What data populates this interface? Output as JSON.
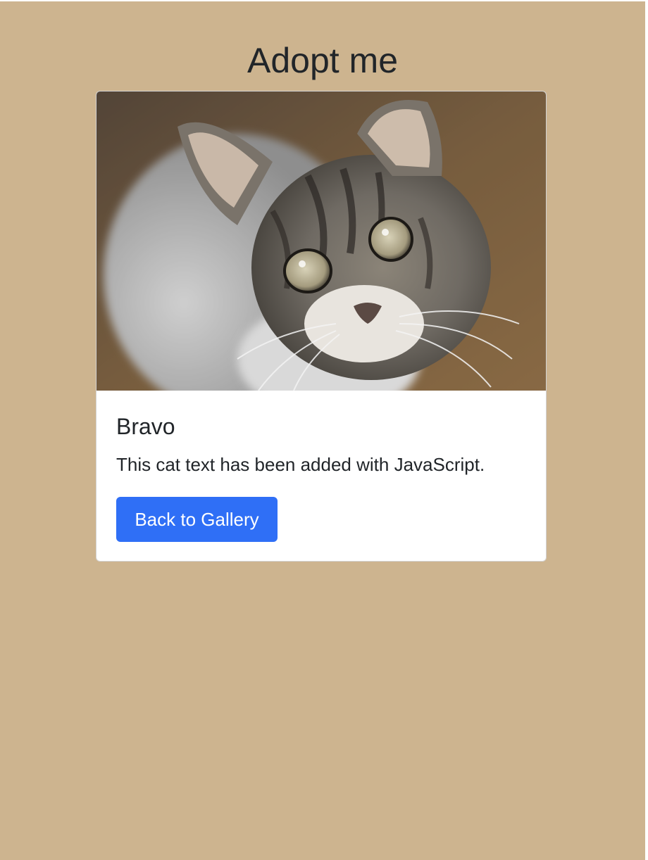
{
  "page": {
    "title": "Adopt me",
    "background_color": "#cdb48f"
  },
  "card": {
    "image_subject": "tabby kitten looking up",
    "title": "Bravo",
    "text": "This cat text has been added with JavaScript.",
    "button_label": "Back to Gallery",
    "button_color": "#2f6ff6"
  }
}
